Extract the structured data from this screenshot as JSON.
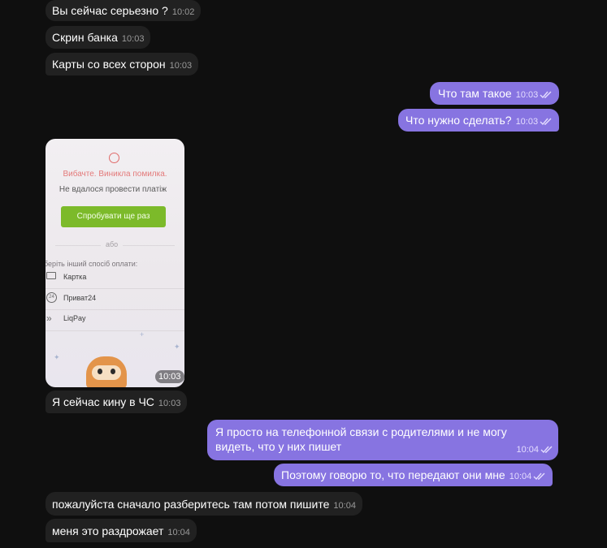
{
  "messages": {
    "m1": {
      "text": "Вы сейчас серьезно ?",
      "time": "10:02"
    },
    "m2": {
      "text": "Скрин банка",
      "time": "10:03"
    },
    "m3": {
      "text": "Карты со всех сторон",
      "time": "10:03"
    },
    "m4": {
      "text": "Что там такое",
      "time": "10:03"
    },
    "m5": {
      "text": "Что нужно сделать?",
      "time": "10:03"
    },
    "m6": {
      "text": "Я сейчас кину в ЧС",
      "time": "10:03"
    },
    "m7": {
      "line1": "Я просто на телефонной связи с родителями и не могу",
      "line2": "видеть, что у них пишет",
      "time": "10:04"
    },
    "m8": {
      "text": "Поэтому говорю то, что передают они мне",
      "time": "10:04"
    },
    "m9": {
      "text": "пожалуйста сначало разберитесь там потом пишите",
      "time": "10:04"
    },
    "m10": {
      "text": "меня это раздрожает",
      "time": "10:04"
    }
  },
  "photo": {
    "error_title": "Вибачте. Виникла помилка.",
    "error_sub": "Не вдалося провести платіж",
    "retry_button": "Спробувати ще раз",
    "or_label": "або",
    "choose_label": "беріть інший спосіб оплати:",
    "options": [
      "Картка",
      "Приват24",
      "LiqPay"
    ],
    "time": "10:03"
  },
  "colors": {
    "incoming": "#212121",
    "outgoing": "#8774e1",
    "background": "#0f0f0f"
  }
}
